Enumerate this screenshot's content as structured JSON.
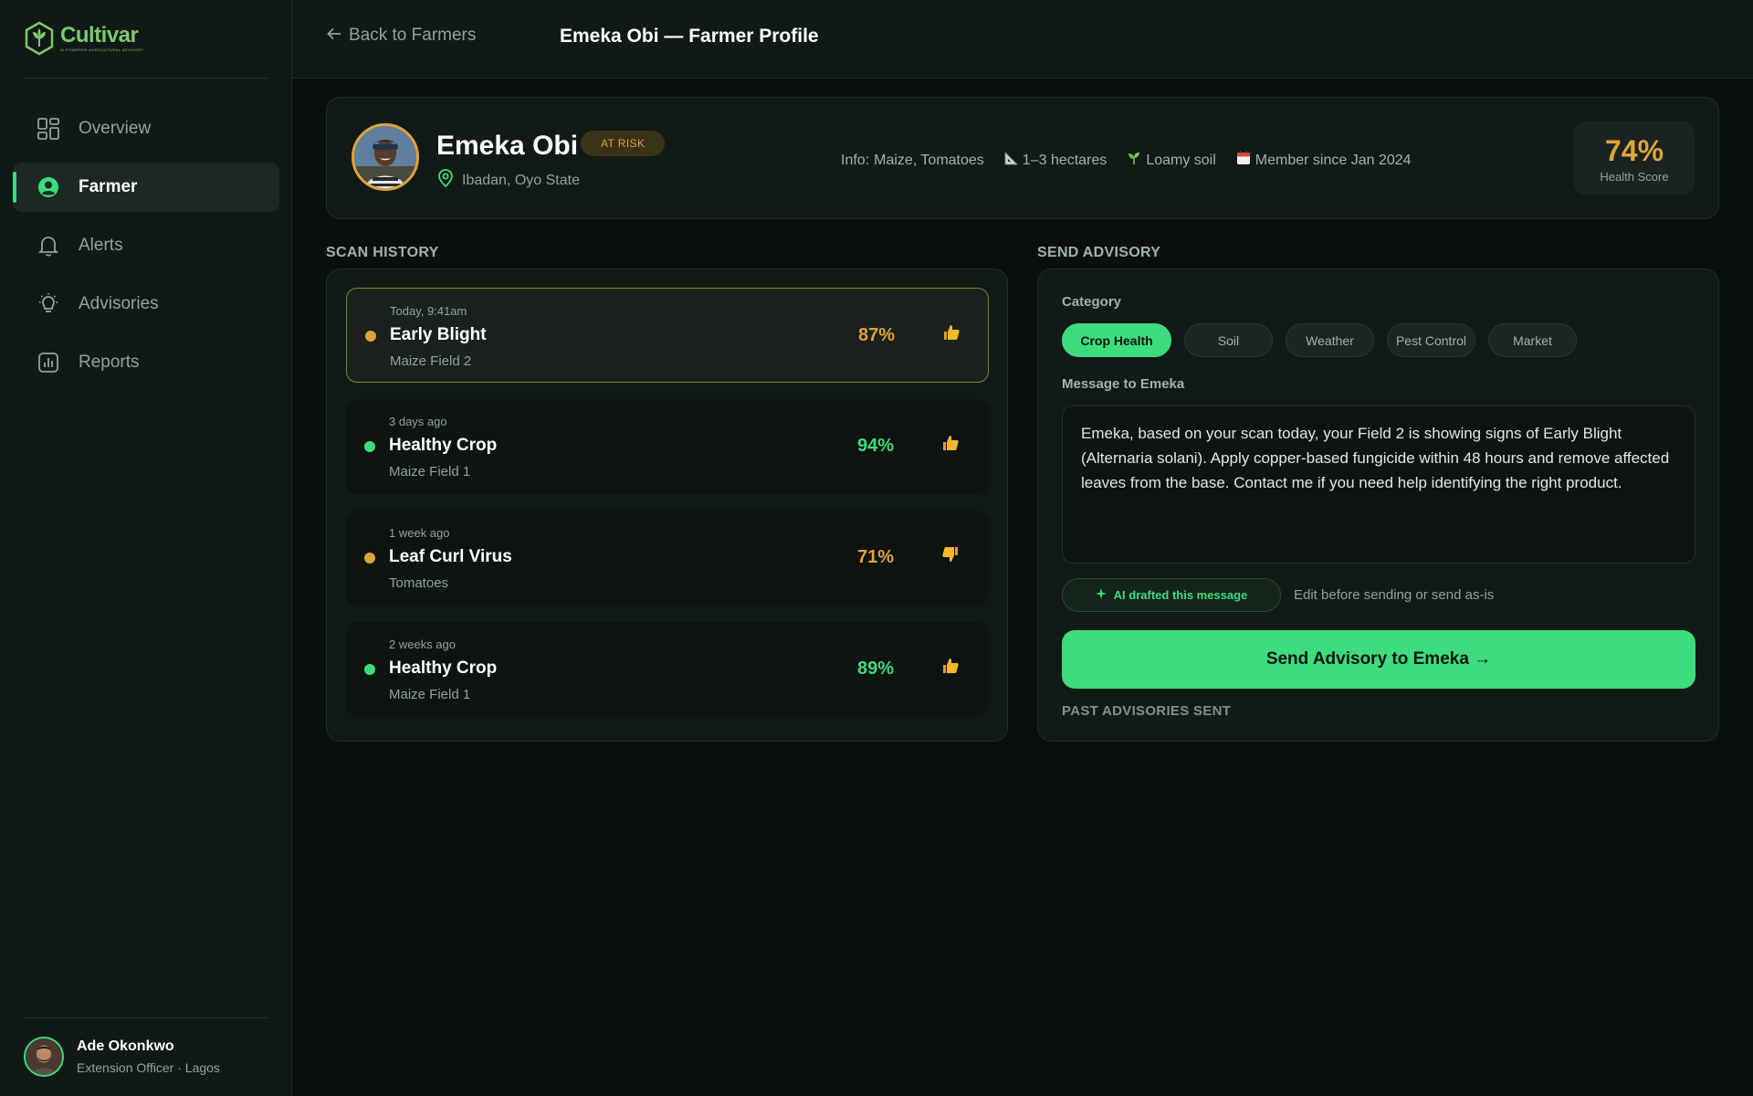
{
  "app": {
    "name": "Cultivar",
    "tagline": "AI-POWERED AGRICULTURAL ADVISORY"
  },
  "colors": {
    "accent": "#3ddc7c",
    "warning": "#e0a33a",
    "background": "#0a100e",
    "panel": "#121a18"
  },
  "sidebar": {
    "items": [
      {
        "label": "Overview",
        "icon": "grid-icon",
        "active": false
      },
      {
        "label": "Farmer",
        "icon": "user-circle-icon",
        "active": true
      },
      {
        "label": "Alerts",
        "icon": "bell-icon",
        "active": false
      },
      {
        "label": "Advisories",
        "icon": "lightbulb-icon",
        "active": false
      },
      {
        "label": "Reports",
        "icon": "bar-chart-icon",
        "active": false
      }
    ],
    "user": {
      "name": "Ade Okonkwo",
      "role": "Extension Officer · Lagos"
    }
  },
  "header": {
    "back_label": "Back to Farmers",
    "title": "Emeka Obi — Farmer Profile"
  },
  "profile": {
    "name": "Emeka Obi",
    "status": "AT RISK",
    "location": "Ibadan, Oyo State",
    "info_label": "Info:",
    "crops": "Maize, Tomatoes",
    "farm_size": "1–3 hectares",
    "soil": "Loamy soil",
    "member_since": "Member since Jan 2024",
    "health_score": "74%",
    "health_label": "Health Score"
  },
  "scan_history": {
    "heading": "SCAN HISTORY",
    "items": [
      {
        "time": "Today, 9:41am",
        "title": "Early Blight",
        "field": "Maize Field 2",
        "confidence": "87%",
        "status": "warning",
        "feedback": "thumbs-up"
      },
      {
        "time": "3 days ago",
        "title": "Healthy Crop",
        "field": "Maize Field 1",
        "confidence": "94%",
        "status": "healthy",
        "feedback": "thumbs-up"
      },
      {
        "time": "1 week ago",
        "title": "Leaf Curl Virus",
        "field": "Tomatoes",
        "confidence": "71%",
        "status": "warning",
        "feedback": "thumbs-down"
      },
      {
        "time": "2 weeks ago",
        "title": "Healthy Crop",
        "field": "Maize Field 1",
        "confidence": "89%",
        "status": "healthy",
        "feedback": "thumbs-up"
      }
    ]
  },
  "advisory": {
    "heading": "SEND ADVISORY",
    "category_label": "Category",
    "categories": [
      "Crop Health",
      "Soil",
      "Weather",
      "Pest Control",
      "Market"
    ],
    "selected_category": "Crop Health",
    "message_label": "Message to Emeka",
    "message": "Emeka, based on your scan today, your Field 2 is showing signs of Early Blight (Alternaria solani). Apply copper-based fungicide within 48 hours and remove affected leaves from the base. Contact me if you need help identifying the right product.",
    "ai_badge": "AI drafted this message",
    "ai_hint": "Edit before sending or send as-is",
    "send_label": "Send Advisory to Emeka →",
    "past_heading": "PAST ADVISORIES SENT"
  }
}
